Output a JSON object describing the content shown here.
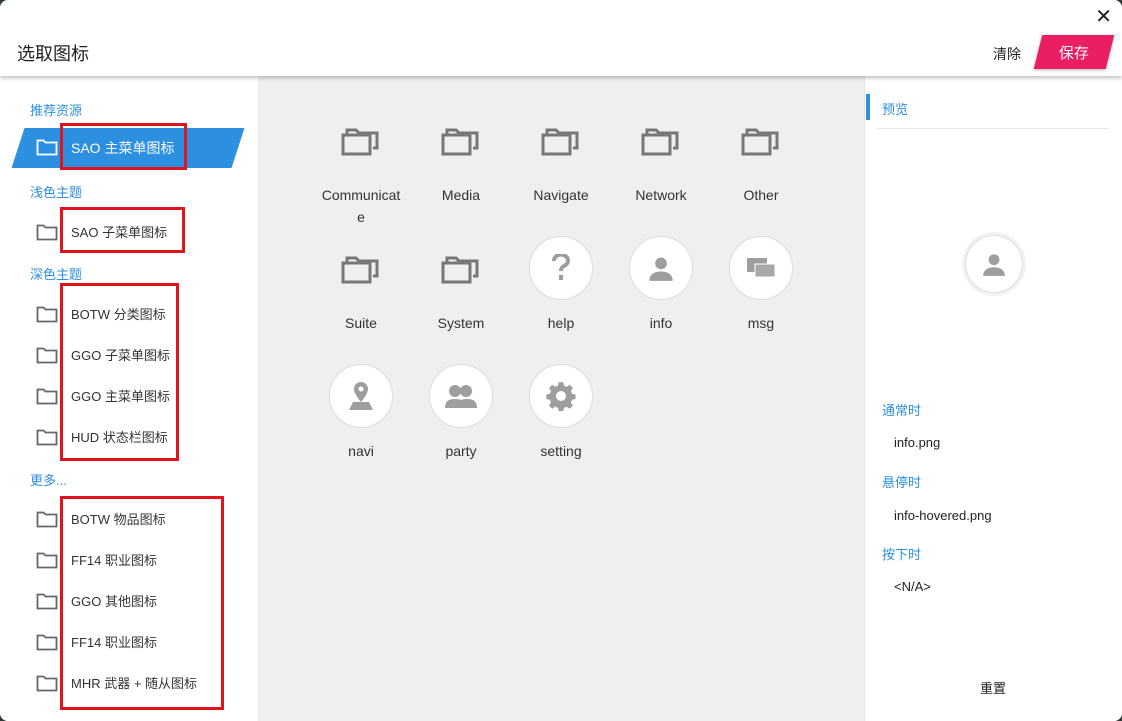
{
  "header": {
    "title": "选取图标",
    "close": "✕",
    "clear_label": "清除",
    "save_label": "保存"
  },
  "sidebar": {
    "sections": [
      "推荐资源",
      "浅色主题",
      "深色主题",
      "更多..."
    ],
    "items": [
      "SAO 主菜单图标",
      "SAO 子菜单图标",
      "BOTW 分类图标",
      "GGO 子菜单图标",
      "GGO 主菜单图标",
      "HUD 状态栏图标",
      "BOTW 物品图标",
      "FF14 职业图标",
      "GGO 其他图标",
      "FF14 职业图标",
      "MHR 武器 + 随从图标"
    ],
    "selected": 0
  },
  "grid": {
    "items": [
      {
        "name": "Communicate",
        "type": "folder"
      },
      {
        "name": "Media",
        "type": "folder"
      },
      {
        "name": "Navigate",
        "type": "folder"
      },
      {
        "name": "Network",
        "type": "folder"
      },
      {
        "name": "Other",
        "type": "folder"
      },
      {
        "name": "Suite",
        "type": "folder"
      },
      {
        "name": "System",
        "type": "folder"
      },
      {
        "name": "help",
        "type": "help-icon"
      },
      {
        "name": "info",
        "type": "user-icon"
      },
      {
        "name": "msg",
        "type": "chat-icon"
      },
      {
        "name": "navi",
        "type": "map-pin-icon"
      },
      {
        "name": "party",
        "type": "group-icon"
      },
      {
        "name": "setting",
        "type": "gear-icon"
      }
    ]
  },
  "preview": {
    "title": "预览",
    "normal_label": "通常时",
    "normal_value": "info.png",
    "hover_label": "悬停时",
    "hover_value": "info-hovered.png",
    "pressed_label": "按下时",
    "pressed_value": "<N/A>",
    "reset_label": "重置"
  },
  "colors": {
    "accent": "#2d8fe0",
    "save": "#e91e63",
    "annotation": "#e0141e"
  }
}
